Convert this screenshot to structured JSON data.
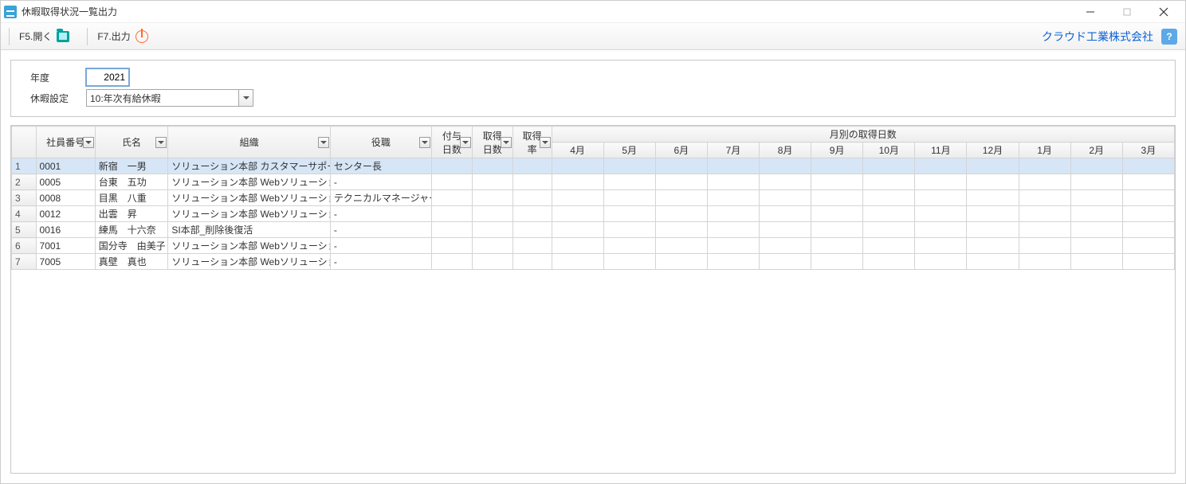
{
  "window": {
    "title": "休暇取得状況一覧出力"
  },
  "toolbar": {
    "open_label": "F5.開く",
    "output_label": "F7.出力",
    "company": "クラウド工業株式会社",
    "help": "?"
  },
  "filters": {
    "year_label": "年度",
    "year_value": "2021",
    "setting_label": "休暇設定",
    "setting_value": "10:年次有給休暇"
  },
  "headers": {
    "emp_no": "社員番号",
    "name": "氏名",
    "org": "組織",
    "position": "役職",
    "granted": "付与\n日数",
    "taken": "取得\n日数",
    "rate": "取得\n率",
    "monthly_group": "月別の取得日数",
    "months": [
      "4月",
      "5月",
      "6月",
      "7月",
      "8月",
      "9月",
      "10月",
      "11月",
      "12月",
      "1月",
      "2月",
      "3月"
    ]
  },
  "rows": [
    {
      "n": 1,
      "emp": "0001",
      "name": "新宿　一男",
      "org": "ソリューション本部 カスタマーサポートセ",
      "pos": "センター長",
      "sel": true
    },
    {
      "n": 2,
      "emp": "0005",
      "name": "台東　五功",
      "org": "ソリューション本部 Webソリューション部",
      "pos": "-",
      "sel": false
    },
    {
      "n": 3,
      "emp": "0008",
      "name": "目黒　八重",
      "org": "ソリューション本部 Webソリューション部",
      "pos": "テクニカルマネージャー",
      "sel": false
    },
    {
      "n": 4,
      "emp": "0012",
      "name": "出雲　昇",
      "org": "ソリューション本部 Webソリューション部",
      "pos": "-",
      "sel": false
    },
    {
      "n": 5,
      "emp": "0016",
      "name": "練馬　十六奈",
      "org": "SI本部_削除後復活",
      "pos": "-",
      "sel": false
    },
    {
      "n": 6,
      "emp": "7001",
      "name": "国分寺　由美子",
      "org": "ソリューション本部 Webソリューション部",
      "pos": "-",
      "sel": false
    },
    {
      "n": 7,
      "emp": "7005",
      "name": "真壁　真也",
      "org": "ソリューション本部 Webソリューション部",
      "pos": "-",
      "sel": false
    }
  ]
}
